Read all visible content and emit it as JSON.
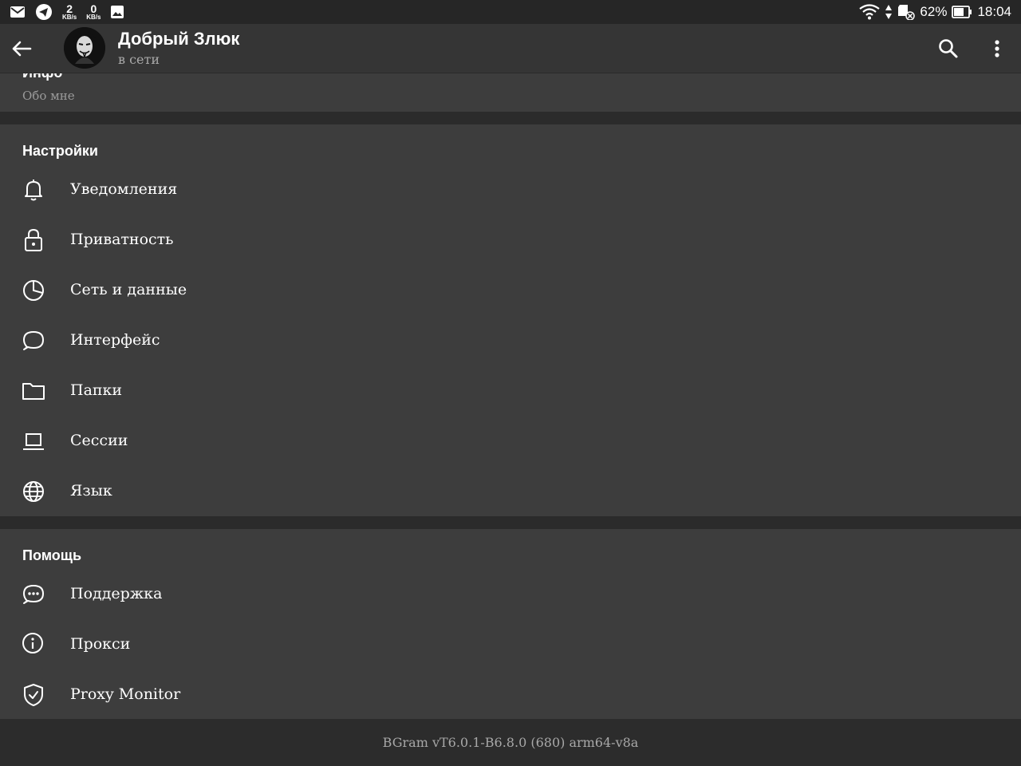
{
  "status_bar": {
    "speed_down": "2",
    "speed_down_unit": "KB/s",
    "speed_up": "0",
    "speed_up_unit": "KB/s",
    "battery": "62%",
    "time": "18:04",
    "icons": [
      "gmail-icon",
      "telegram-icon",
      "image-icon",
      "wifi-icon",
      "sd-card-icon",
      "battery-icon"
    ]
  },
  "header": {
    "title": "Добрый Злюк",
    "subtitle": "в сети"
  },
  "info": {
    "title": "Инфо",
    "about": "Обо мне"
  },
  "settings": {
    "header": "Настройки",
    "items": [
      {
        "label": "Уведомления",
        "icon": "bell-icon"
      },
      {
        "label": "Приватность",
        "icon": "lock-icon"
      },
      {
        "label": "Сеть и данные",
        "icon": "pie-chart-icon"
      },
      {
        "label": "Интерфейс",
        "icon": "chat-bubble-icon"
      },
      {
        "label": "Папки",
        "icon": "folder-icon"
      },
      {
        "label": "Сессии",
        "icon": "laptop-icon"
      },
      {
        "label": "Язык",
        "icon": "globe-icon"
      }
    ]
  },
  "help": {
    "header": "Помощь",
    "items": [
      {
        "label": "Поддержка",
        "icon": "chat-dots-icon"
      },
      {
        "label": "Прокси",
        "icon": "info-icon"
      },
      {
        "label": "Proxy Monitor",
        "icon": "shield-check-icon"
      }
    ]
  },
  "footer": {
    "version": "BGram vT6.0.1-B6.8.0 (680) arm64-v8a"
  },
  "colors": {
    "background": "#2b2b2b",
    "section": "#3d3d3d",
    "app_bar": "#353535",
    "text_primary": "#ffffff",
    "text_secondary": "#a9a9a9"
  }
}
